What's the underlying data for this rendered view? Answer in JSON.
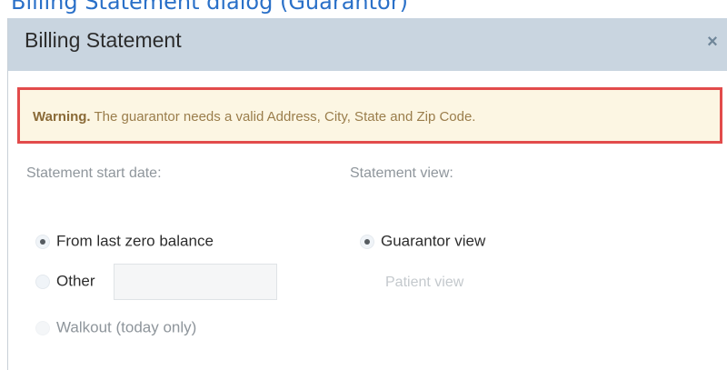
{
  "caption": "Billing Statement dialog (Guarantor)",
  "dialog": {
    "title": "Billing Statement",
    "close_symbol": "×"
  },
  "warning": {
    "strong": "Warning.",
    "message": "The guarantor needs a valid Address, City, State and Zip Code."
  },
  "start_date": {
    "label": "Statement start date:",
    "options": [
      {
        "label": "From last zero balance",
        "selected": true
      },
      {
        "label": "Other",
        "selected": false
      },
      {
        "label": "Walkout (today only)",
        "selected": false
      }
    ],
    "other_value": ""
  },
  "view": {
    "label": "Statement view:",
    "options": [
      {
        "label": "Guarantor view",
        "selected": true
      },
      {
        "label": "Patient view",
        "selected": false
      }
    ]
  },
  "colors": {
    "header_bg": "#c9d5e0",
    "warning_bg": "#fcf6e3",
    "warning_border": "#e24b4b",
    "caption": "#2a70c8"
  },
  "icons": {
    "close": "close-icon"
  }
}
